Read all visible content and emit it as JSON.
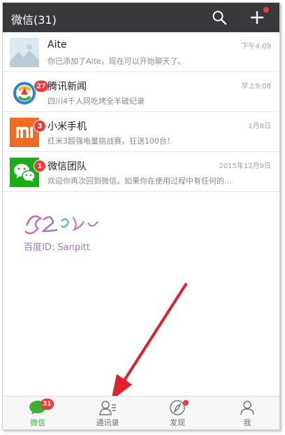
{
  "header": {
    "title": "微信(31)",
    "accent": "#37393b"
  },
  "chats": [
    {
      "name": "Aite",
      "message": "你已添加了Aite，现在可以开始聊天了。",
      "time": "下午4:09",
      "badge": "",
      "avatar": "landscape-placeholder-icon"
    },
    {
      "name": "腾讯新闻",
      "message": "四川4千人同吃烤全羊破纪录",
      "time": "早上9:08",
      "badge": "27",
      "avatar": "tencent-news-icon"
    },
    {
      "name": "小米手机",
      "message": "红米3超强电量挑战赛，狂送100台！",
      "time": "1月8日",
      "badge": "3",
      "avatar": "xiaomi-logo-icon"
    },
    {
      "name": "微信团队",
      "message": "欢迎你再次回到微信。如果你在使用过程中有任何的…",
      "time": "2015年12月9日",
      "badge": "1",
      "avatar": "wechat-logo-icon"
    }
  ],
  "watermark": {
    "text": "百度ID: Sanpitt"
  },
  "tabs": [
    {
      "label": "微信",
      "badge": "31",
      "active": true
    },
    {
      "label": "通讯录",
      "badge": "",
      "active": false
    },
    {
      "label": "发现",
      "badge": "",
      "dot": true,
      "active": false
    },
    {
      "label": "我",
      "badge": "",
      "active": false
    }
  ],
  "colors": {
    "wechat_green": "#3caf36",
    "badge_red": "#f23a3a",
    "arrow_red": "#e0202a",
    "xiaomi_orange": "#f26b22"
  }
}
